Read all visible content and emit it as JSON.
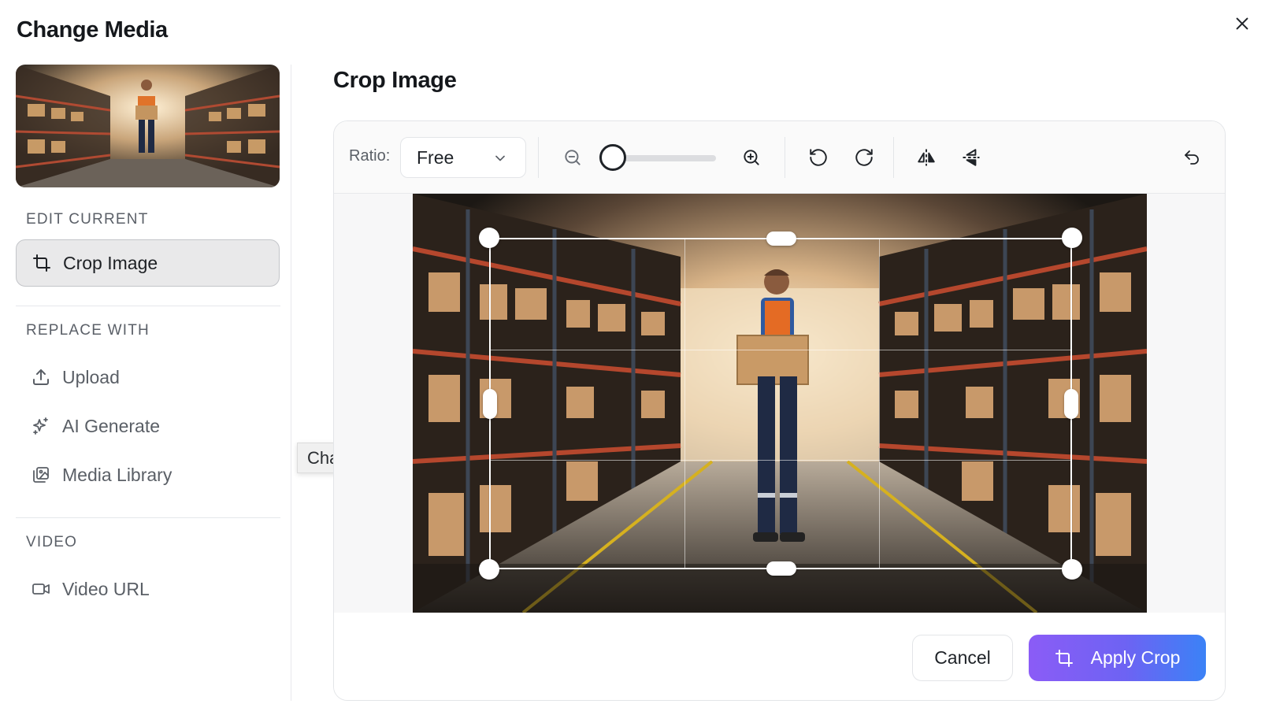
{
  "modal": {
    "title": "Change Media"
  },
  "sidebar": {
    "sections": [
      {
        "label": "EDIT CURRENT",
        "items": [
          {
            "label": "Crop Image",
            "icon": "crop-icon",
            "active": true
          }
        ]
      },
      {
        "label": "REPLACE WITH",
        "items": [
          {
            "label": "Upload",
            "icon": "upload-icon"
          },
          {
            "label": "AI Generate",
            "icon": "sparkles-icon"
          },
          {
            "label": "Media Library",
            "icon": "images-icon"
          }
        ]
      },
      {
        "label": "VIDEO",
        "items": [
          {
            "label": "Video URL",
            "icon": "video-icon"
          }
        ]
      }
    ]
  },
  "tooltip": {
    "text": "Change Media"
  },
  "main": {
    "title": "Crop Image",
    "toolbar": {
      "ratio_label": "Ratio:",
      "ratio_value": "Free",
      "zoom_level": 0
    },
    "footer": {
      "cancel_label": "Cancel",
      "apply_label": "Apply Crop"
    }
  },
  "colors": {
    "accent_start": "#8b5cf6",
    "accent_end": "#3b82f6"
  }
}
